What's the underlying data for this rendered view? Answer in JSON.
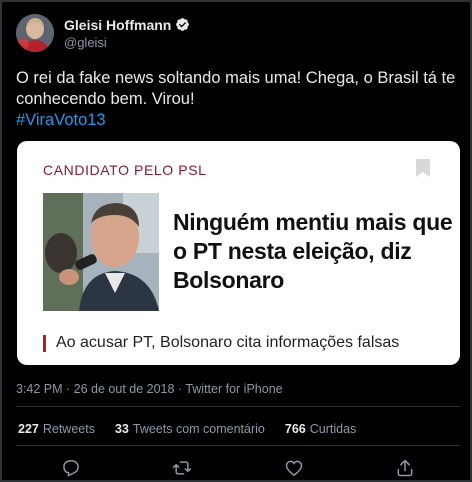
{
  "author": {
    "display_name": "Gleisi Hoffmann",
    "handle": "@gleisi",
    "verified_icon": "verified-badge-icon"
  },
  "tweet": {
    "text": "O rei da fake news soltando mais uma! Chega, o Brasil tá te conhecendo bem. Virou!",
    "hashtag": "#ViraVoto13"
  },
  "card": {
    "kicker": "CANDIDATO PELO PSL",
    "headline": "Ninguém mentiu mais que o PT nesta eleição, diz Bolsonaro",
    "subheadline": "Ao acusar PT, Bolsonaro cita informações falsas",
    "kicker_color": "#8c1b2f",
    "accent_color": "#c4122f"
  },
  "meta": {
    "timestamp": "3:42 PM · 26 de out de 2018 · Twitter for iPhone"
  },
  "stats": {
    "retweets_count": "227",
    "retweets_label": "Retweets",
    "quotes_count": "33",
    "quotes_label": "Tweets com comentário",
    "likes_count": "766",
    "likes_label": "Curtidas"
  },
  "actions": {
    "reply_icon": "reply-icon",
    "retweet_icon": "retweet-icon",
    "like_icon": "heart-icon",
    "share_icon": "share-icon"
  },
  "colors": {
    "background": "#000000",
    "link": "#1d9bf0",
    "secondary_text": "#8b98a5"
  }
}
